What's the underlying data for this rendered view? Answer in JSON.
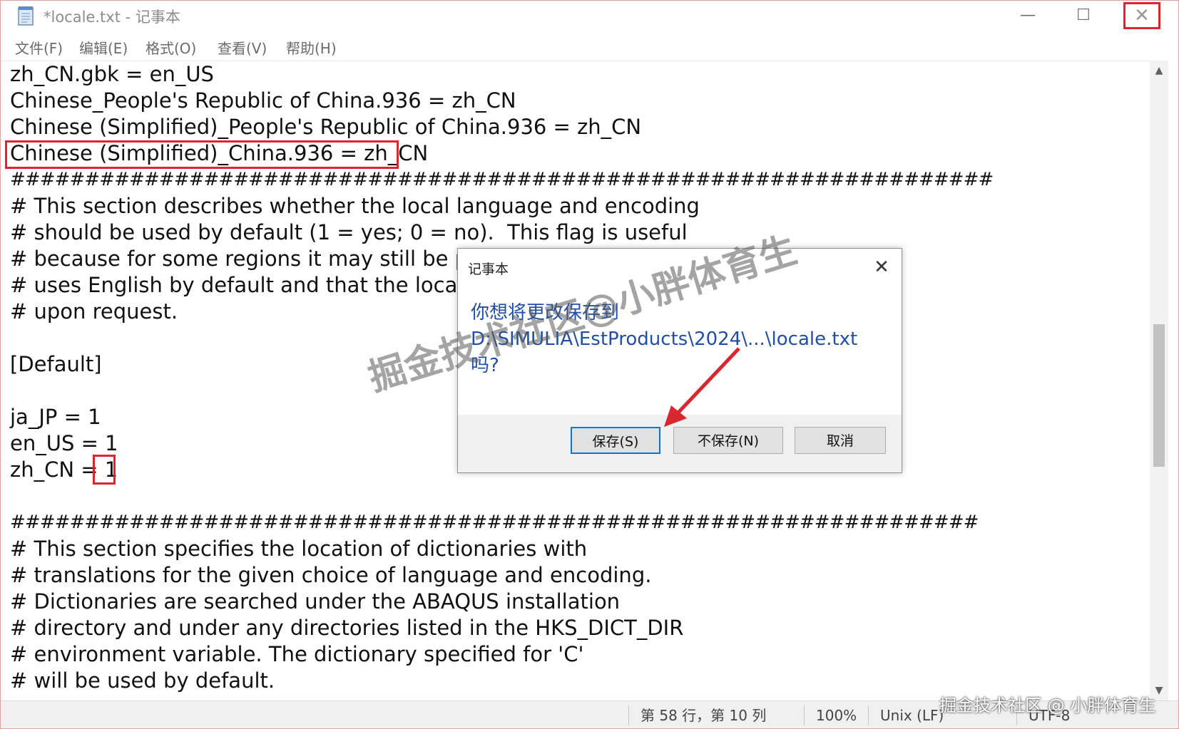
{
  "window": {
    "title": "*locale.txt - 记事本",
    "controls": {
      "minimize": "—",
      "maximize": "☐",
      "close": "✕"
    }
  },
  "menu": {
    "items": [
      {
        "label": "文件(F)"
      },
      {
        "label": "编辑(E)"
      },
      {
        "label": "格式(O)"
      },
      {
        "label": "查看(V)"
      },
      {
        "label": "帮助(H)"
      }
    ]
  },
  "editor": {
    "lines": [
      "zh_CN.gbk = en_US",
      "Chinese_People's Republic of China.936 = zh_CN",
      "Chinese (Simplified)_People's Republic of China.936 = zh_CN",
      "Chinese (Simplified)_China.936 = zh_CN",
      "##################################################################",
      "# This section describes whether the local language and encoding",
      "# should be used by default (1 = yes; 0 = no).  This flag is useful",
      "# because for some regions it may still be pref",
      "# uses English by default and that the local lan",
      "# upon request.",
      "",
      "[Default]",
      "",
      "ja_JP = 1",
      "en_US = 1",
      "zh_CN = 1",
      "",
      "#################################################################",
      "# This section specifies the location of dictionaries with",
      "# translations for the given choice of language and encoding.",
      "# Dictionaries are searched under the ABAQUS installation",
      "# directory and under any directories listed in the HKS_DICT_DIR",
      "# environment variable. The dictionary specified for 'C'",
      "# will be used by default."
    ]
  },
  "dialog": {
    "title": "记事本",
    "close": "✕",
    "message_line1": "你想将更改保存到",
    "message_line2": "D:\\SIMULIA\\EstProducts\\2024\\...\\locale.txt",
    "message_line3": "吗?",
    "buttons": {
      "save": "保存(S)",
      "dont_save": "不保存(N)",
      "cancel": "取消"
    }
  },
  "statusbar": {
    "position": "第 58 行，第 10 列",
    "zoom": "100%",
    "line_ending": "Unix (LF)",
    "encoding": "UTF-8"
  },
  "watermark": {
    "main": "掘金技术社区@小胖体育生",
    "corner": "掘金技术社区 @ 小胖体育生"
  },
  "colors": {
    "highlight": "#d9262f",
    "dialog_text": "#1f4fa6",
    "default_button_border": "#0078d7"
  }
}
